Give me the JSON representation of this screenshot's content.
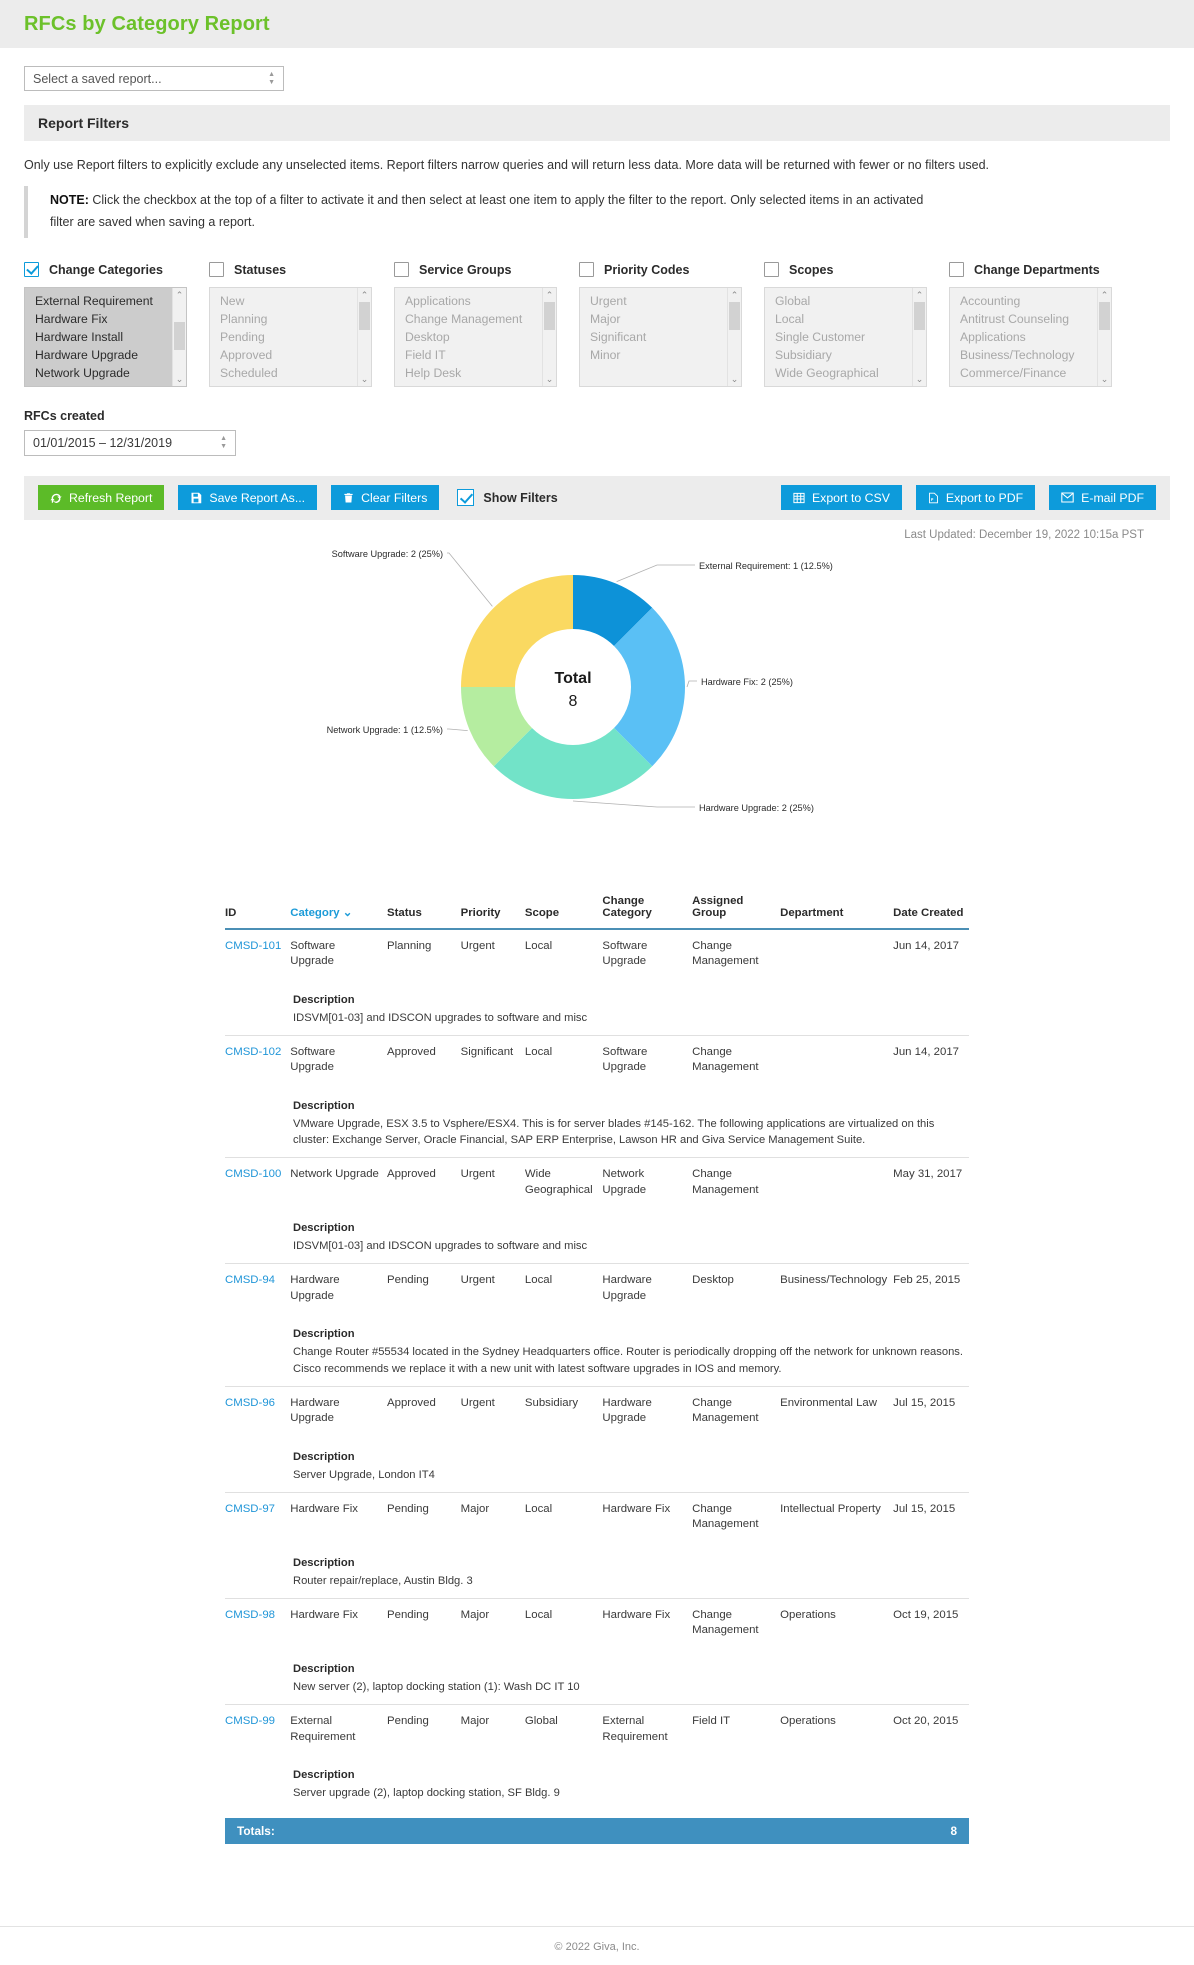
{
  "header": {
    "title": "RFCs by Category Report"
  },
  "saved_report": {
    "placeholder": "Select a saved report...",
    "value": "Select a saved report..."
  },
  "filters_panel": {
    "title": "Report Filters",
    "intro": "Only use Report filters to explicitly exclude any unselected items. Report filters narrow queries and will return less data. More data will be returned with fewer or no filters used.",
    "note_label": "NOTE:",
    "note_text": " Click the checkbox at the top of a filter to activate it and then select at least one item to apply the filter to the report. Only selected items in an activated filter are saved when saving a report."
  },
  "filters": [
    {
      "label": "Change Categories",
      "checked": true,
      "items": [
        "External Requirement",
        "Hardware Fix",
        "Hardware Install",
        "Hardware Upgrade",
        "Network Upgrade"
      ]
    },
    {
      "label": "Statuses",
      "checked": false,
      "items": [
        "New",
        "Planning",
        "Pending",
        "Approved",
        "Scheduled"
      ]
    },
    {
      "label": "Service Groups",
      "checked": false,
      "items": [
        "Applications",
        "Change Management",
        "Desktop",
        "Field IT",
        "Help Desk"
      ]
    },
    {
      "label": "Priority Codes",
      "checked": false,
      "items": [
        "Urgent",
        "Major",
        "Significant",
        "Minor"
      ]
    },
    {
      "label": "Scopes",
      "checked": false,
      "items": [
        "Global",
        "Local",
        "Single Customer",
        "Subsidiary",
        "Wide Geographical"
      ]
    },
    {
      "label": "Change Departments",
      "checked": false,
      "items": [
        "Accounting",
        "Antitrust Counseling",
        "Applications",
        "Business/Technology",
        "Commerce/Finance"
      ]
    }
  ],
  "date_filter": {
    "label": "RFCs created",
    "value": "01/01/2015 – 12/31/2019"
  },
  "toolbar": {
    "refresh_label": "Refresh Report",
    "save_label": "Save Report As...",
    "clear_label": "Clear Filters",
    "show_filters_label": "Show Filters",
    "show_filters_checked": true,
    "export_csv_label": "Export to CSV",
    "export_pdf_label": "Export to PDF",
    "email_pdf_label": "E-mail PDF"
  },
  "last_updated": "Last Updated: December 19, 2022 10:15a PST",
  "chart_data": {
    "type": "pie",
    "title": "",
    "total_label": "Total",
    "total_value": "8",
    "categories": [
      "External Requirement",
      "Hardware Fix",
      "Hardware Upgrade",
      "Network Upgrade",
      "Software Upgrade"
    ],
    "values": [
      1,
      2,
      2,
      1,
      2
    ],
    "percents": [
      "12.5%",
      "25%",
      "25%",
      "12.5%",
      "25%"
    ],
    "colors": [
      "#0d92d8",
      "#5ac0f5",
      "#72e3c8",
      "#b5eda0",
      "#fad961"
    ],
    "labels": [
      "External Requirement: 1 (12.5%)",
      "Hardware Fix: 2 (25%)",
      "Hardware Upgrade: 2 (25%)",
      "Network Upgrade: 1 (12.5%)",
      "Software Upgrade: 2 (25%)"
    ],
    "legend": "callout-labels",
    "donut": true
  },
  "table": {
    "columns": [
      "ID",
      "Category",
      "Status",
      "Priority",
      "Scope",
      "Change Category",
      "Assigned Group",
      "Department",
      "Date Created"
    ],
    "sorted_column": "Category",
    "description_label": "Description",
    "rows": [
      {
        "id": "CMSD-101",
        "category": "Software Upgrade",
        "status": "Planning",
        "priority": "Urgent",
        "scope": "Local",
        "change_category": "Software Upgrade",
        "assigned_group": "Change Management",
        "department": "",
        "date_created": "Jun 14, 2017",
        "description": "IDSVM[01-03] and IDSCON upgrades to software and misc"
      },
      {
        "id": "CMSD-102",
        "category": "Software Upgrade",
        "status": "Approved",
        "priority": "Significant",
        "scope": "Local",
        "change_category": "Software Upgrade",
        "assigned_group": "Change Management",
        "department": "",
        "date_created": "Jun 14, 2017",
        "description": "VMware Upgrade, ESX 3.5 to Vsphere/ESX4. This is for server blades #145-162. The following applications are virtualized on this cluster: Exchange Server, Oracle Financial, SAP ERP Enterprise, Lawson HR and Giva Service Management Suite."
      },
      {
        "id": "CMSD-100",
        "category": "Network Upgrade",
        "status": "Approved",
        "priority": "Urgent",
        "scope": "Wide Geographical",
        "change_category": "Network Upgrade",
        "assigned_group": "Change Management",
        "department": "",
        "date_created": "May 31, 2017",
        "description": "IDSVM[01-03] and IDSCON upgrades to software and misc"
      },
      {
        "id": "CMSD-94",
        "category": "Hardware Upgrade",
        "status": "Pending",
        "priority": "Urgent",
        "scope": "Local",
        "change_category": "Hardware Upgrade",
        "assigned_group": "Desktop",
        "department": "Business/Technology",
        "date_created": "Feb 25, 2015",
        "description": "Change Router #55534 located in the Sydney Headquarters office. Router is periodically dropping off the network for unknown reasons. Cisco recommends we replace it with a new unit with latest software upgrades in IOS and memory."
      },
      {
        "id": "CMSD-96",
        "category": "Hardware Upgrade",
        "status": "Approved",
        "priority": "Urgent",
        "scope": "Subsidiary",
        "change_category": "Hardware Upgrade",
        "assigned_group": "Change Management",
        "department": "Environmental Law",
        "date_created": "Jul 15, 2015",
        "description": "Server Upgrade, London IT4"
      },
      {
        "id": "CMSD-97",
        "category": "Hardware Fix",
        "status": "Pending",
        "priority": "Major",
        "scope": "Local",
        "change_category": "Hardware Fix",
        "assigned_group": "Change Management",
        "department": "Intellectual Property",
        "date_created": "Jul 15, 2015",
        "description": "Router repair/replace, Austin Bldg. 3"
      },
      {
        "id": "CMSD-98",
        "category": "Hardware Fix",
        "status": "Pending",
        "priority": "Major",
        "scope": "Local",
        "change_category": "Hardware Fix",
        "assigned_group": "Change Management",
        "department": "Operations",
        "date_created": "Oct 19, 2015",
        "description": "New server (2), laptop docking station (1): Wash DC IT 10"
      },
      {
        "id": "CMSD-99",
        "category": "External Requirement",
        "status": "Pending",
        "priority": "Major",
        "scope": "Global",
        "change_category": "External Requirement",
        "assigned_group": "Field IT",
        "department": "Operations",
        "date_created": "Oct 20, 2015",
        "description": "Server upgrade (2), laptop docking station, SF Bldg. 9"
      }
    ],
    "totals_label": "Totals:",
    "totals_value": "8"
  },
  "footer": {
    "copyright": "© 2022 Giva, Inc."
  }
}
